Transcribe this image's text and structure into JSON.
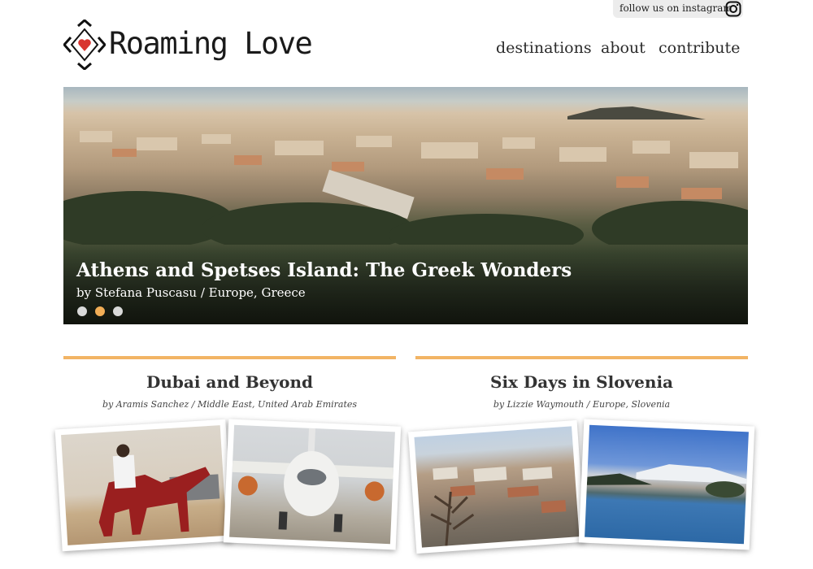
{
  "header": {
    "instagram_label": "follow us on instagram",
    "logo_text": "Roaming Love",
    "nav": [
      "destinations",
      "about",
      "contribute"
    ]
  },
  "hero": {
    "title": "Athens and Spetses Island: The Greek Wonders",
    "meta": "by Stefana Puscasu / Europe, Greece",
    "slides": 3,
    "active_slide": 2
  },
  "posts": [
    {
      "title": "Dubai and Beyond",
      "meta": "by Aramis Sanchez / Middle East, United Arab Emirates"
    },
    {
      "title": "Six Days in Slovenia",
      "meta": "by Lizzie Waymouth / Europe, Slovenia"
    }
  ],
  "colors": {
    "accent": "#f2b465",
    "active_dot": "#f2ad56",
    "logo_heart": "#d8352f",
    "text": "#333333"
  },
  "icons": [
    "instagram-icon",
    "diamond-heart-logo"
  ]
}
